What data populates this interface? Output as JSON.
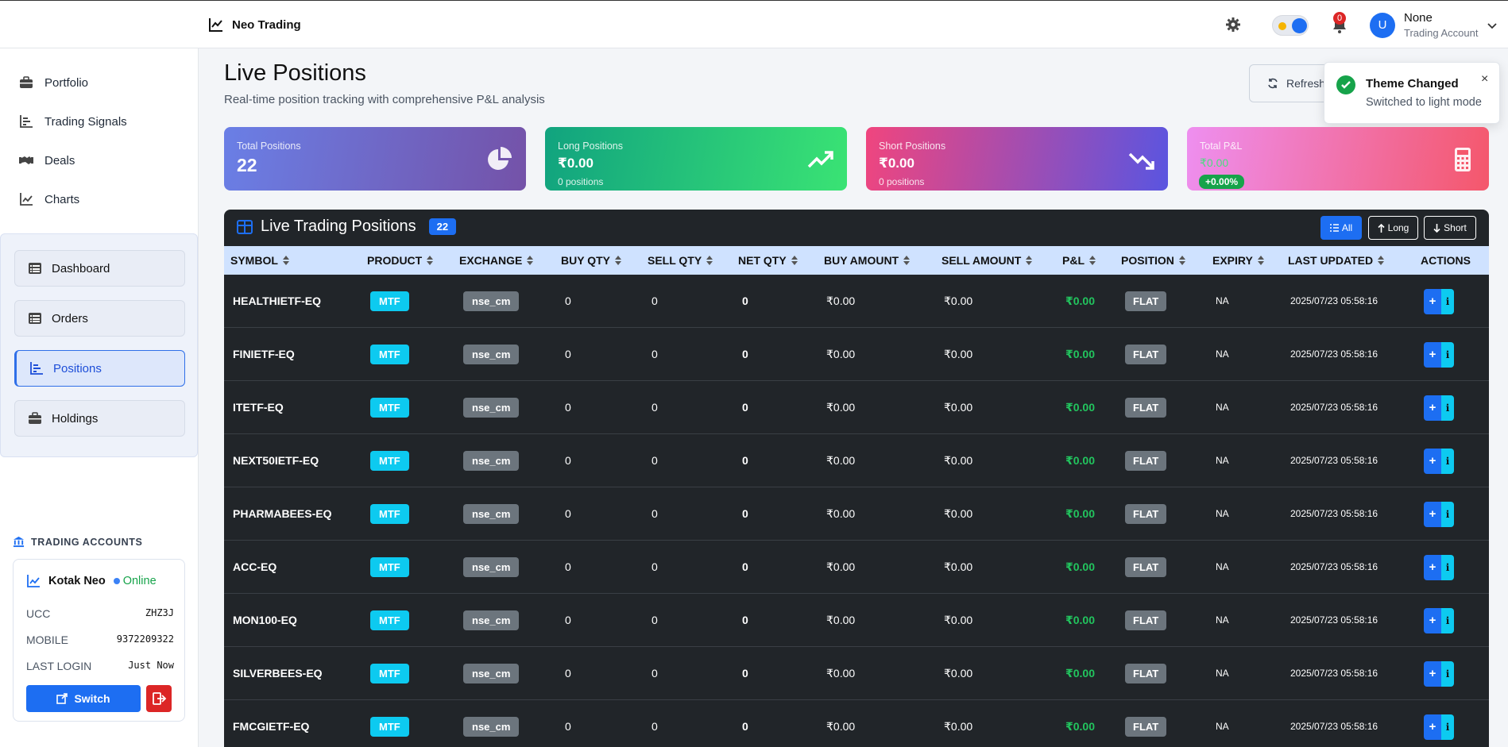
{
  "brand": {
    "title": "Neo Trading"
  },
  "user": {
    "avatar_letter": "U",
    "name": "None",
    "subtitle": "Trading Account",
    "notification_count": "0"
  },
  "sidebar": {
    "items": [
      {
        "label": "Portfolio",
        "icon": "briefcase-icon"
      },
      {
        "label": "Trading Signals",
        "icon": "bar-chart-icon"
      },
      {
        "label": "Deals",
        "icon": "handshake-icon"
      },
      {
        "label": "Charts",
        "icon": "line-chart-icon"
      }
    ],
    "sub_items": [
      {
        "label": "Dashboard",
        "icon": "list-icon",
        "active": false
      },
      {
        "label": "Orders",
        "icon": "list-icon",
        "active": false
      },
      {
        "label": "Positions",
        "icon": "bar-chart-icon",
        "active": true
      },
      {
        "label": "Holdings",
        "icon": "briefcase-icon",
        "active": false
      }
    ]
  },
  "accounts": {
    "title": "TRADING ACCOUNTS",
    "broker": "Kotak Neo",
    "status": "Online",
    "ucc_label": "UCC",
    "ucc": "ZHZ3J",
    "mobile_label": "MOBILE",
    "mobile": "9372209322",
    "last_login_label": "LAST LOGIN",
    "last_login": "Just Now",
    "switch_label": "Switch"
  },
  "header": {
    "title": "Live Positions",
    "subtitle": "Real-time position tracking with comprehensive P&L analysis",
    "refresh_label": "Refresh"
  },
  "toast": {
    "title": "Theme Changed",
    "message": "Switched to light mode",
    "close": "×"
  },
  "stats": {
    "total": {
      "label": "Total Positions",
      "value": "22"
    },
    "long": {
      "label": "Long Positions",
      "value": "₹0.00",
      "sub": "0 positions"
    },
    "short": {
      "label": "Short Positions",
      "value": "₹0.00",
      "sub": "0 positions"
    },
    "pnl": {
      "label": "Total P&L",
      "value": "₹0.00",
      "pct": "+0.00%"
    }
  },
  "table": {
    "title": "Live Trading Positions",
    "count": "22",
    "filters": {
      "all": "All",
      "long": "Long",
      "short": "Short"
    },
    "columns": [
      "SYMBOL",
      "PRODUCT",
      "EXCHANGE",
      "BUY QTY",
      "SELL QTY",
      "NET QTY",
      "BUY AMOUNT",
      "SELL AMOUNT",
      "P&L",
      "POSITION",
      "EXPIRY",
      "LAST UPDATED",
      "ACTIONS"
    ],
    "rows": [
      {
        "symbol": "HEALTHIETF-EQ",
        "product": "MTF",
        "exchange": "nse_cm",
        "buy_qty": "0",
        "sell_qty": "0",
        "net_qty": "0",
        "buy_amount": "₹0.00",
        "sell_amount": "₹0.00",
        "pnl": "₹0.00",
        "position": "FLAT",
        "expiry": "NA",
        "updated": "2025/07/23 05:58:16"
      },
      {
        "symbol": "FINIETF-EQ",
        "product": "MTF",
        "exchange": "nse_cm",
        "buy_qty": "0",
        "sell_qty": "0",
        "net_qty": "0",
        "buy_amount": "₹0.00",
        "sell_amount": "₹0.00",
        "pnl": "₹0.00",
        "position": "FLAT",
        "expiry": "NA",
        "updated": "2025/07/23 05:58:16"
      },
      {
        "symbol": "ITETF-EQ",
        "product": "MTF",
        "exchange": "nse_cm",
        "buy_qty": "0",
        "sell_qty": "0",
        "net_qty": "0",
        "buy_amount": "₹0.00",
        "sell_amount": "₹0.00",
        "pnl": "₹0.00",
        "position": "FLAT",
        "expiry": "NA",
        "updated": "2025/07/23 05:58:16"
      },
      {
        "symbol": "NEXT50IETF-EQ",
        "product": "MTF",
        "exchange": "nse_cm",
        "buy_qty": "0",
        "sell_qty": "0",
        "net_qty": "0",
        "buy_amount": "₹0.00",
        "sell_amount": "₹0.00",
        "pnl": "₹0.00",
        "position": "FLAT",
        "expiry": "NA",
        "updated": "2025/07/23 05:58:16"
      },
      {
        "symbol": "PHARMABEES-EQ",
        "product": "MTF",
        "exchange": "nse_cm",
        "buy_qty": "0",
        "sell_qty": "0",
        "net_qty": "0",
        "buy_amount": "₹0.00",
        "sell_amount": "₹0.00",
        "pnl": "₹0.00",
        "position": "FLAT",
        "expiry": "NA",
        "updated": "2025/07/23 05:58:16"
      },
      {
        "symbol": "ACC-EQ",
        "product": "MTF",
        "exchange": "nse_cm",
        "buy_qty": "0",
        "sell_qty": "0",
        "net_qty": "0",
        "buy_amount": "₹0.00",
        "sell_amount": "₹0.00",
        "pnl": "₹0.00",
        "position": "FLAT",
        "expiry": "NA",
        "updated": "2025/07/23 05:58:16"
      },
      {
        "symbol": "MON100-EQ",
        "product": "MTF",
        "exchange": "nse_cm",
        "buy_qty": "0",
        "sell_qty": "0",
        "net_qty": "0",
        "buy_amount": "₹0.00",
        "sell_amount": "₹0.00",
        "pnl": "₹0.00",
        "position": "FLAT",
        "expiry": "NA",
        "updated": "2025/07/23 05:58:16"
      },
      {
        "symbol": "SILVERBEES-EQ",
        "product": "MTF",
        "exchange": "nse_cm",
        "buy_qty": "0",
        "sell_qty": "0",
        "net_qty": "0",
        "buy_amount": "₹0.00",
        "sell_amount": "₹0.00",
        "pnl": "₹0.00",
        "position": "FLAT",
        "expiry": "NA",
        "updated": "2025/07/23 05:58:16"
      },
      {
        "symbol": "FMCGIETF-EQ",
        "product": "MTF",
        "exchange": "nse_cm",
        "buy_qty": "0",
        "sell_qty": "0",
        "net_qty": "0",
        "buy_amount": "₹0.00",
        "sell_amount": "₹0.00",
        "pnl": "₹0.00",
        "position": "FLAT",
        "expiry": "NA",
        "updated": "2025/07/23 05:58:16"
      }
    ],
    "action_add": "+",
    "action_info": "i"
  },
  "colors": {
    "primary": "#1d6ef2",
    "success": "#16a34a",
    "danger": "#dc2626",
    "info": "#0dcaf0",
    "table_dark": "#212529",
    "table_head": "#cfe2ff"
  }
}
